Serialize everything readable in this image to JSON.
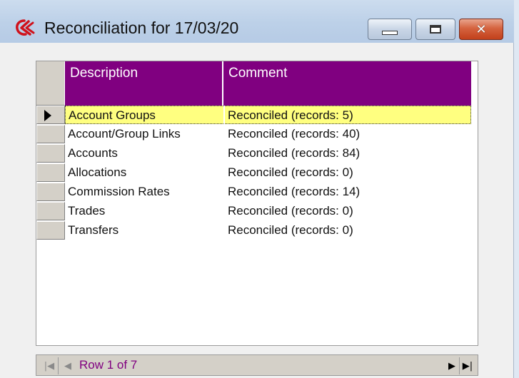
{
  "window": {
    "title": "Reconciliation for 17/03/20"
  },
  "grid": {
    "columns": [
      "Description",
      "Comment"
    ],
    "selected_row": 1,
    "rows": [
      {
        "description": "Account Groups",
        "comment": "Reconciled (records: 5)"
      },
      {
        "description": "Account/Group Links",
        "comment": "Reconciled (records: 40)"
      },
      {
        "description": "Accounts",
        "comment": "Reconciled (records: 84)"
      },
      {
        "description": "Allocations",
        "comment": "Reconciled (records: 0)"
      },
      {
        "description": "Commission Rates",
        "comment": "Reconciled (records: 14)"
      },
      {
        "description": "Trades",
        "comment": "Reconciled (records: 0)"
      },
      {
        "description": "Transfers",
        "comment": "Reconciled (records: 0)"
      }
    ]
  },
  "navigator": {
    "label": "Row 1 of 7",
    "icons": [
      "first-record-icon",
      "previous-record-icon",
      "next-record-icon",
      "last-record-icon"
    ]
  },
  "colors": {
    "header_bg": "#800080",
    "selected_row_bg": "#ffff80",
    "nav_label": "#800080"
  }
}
